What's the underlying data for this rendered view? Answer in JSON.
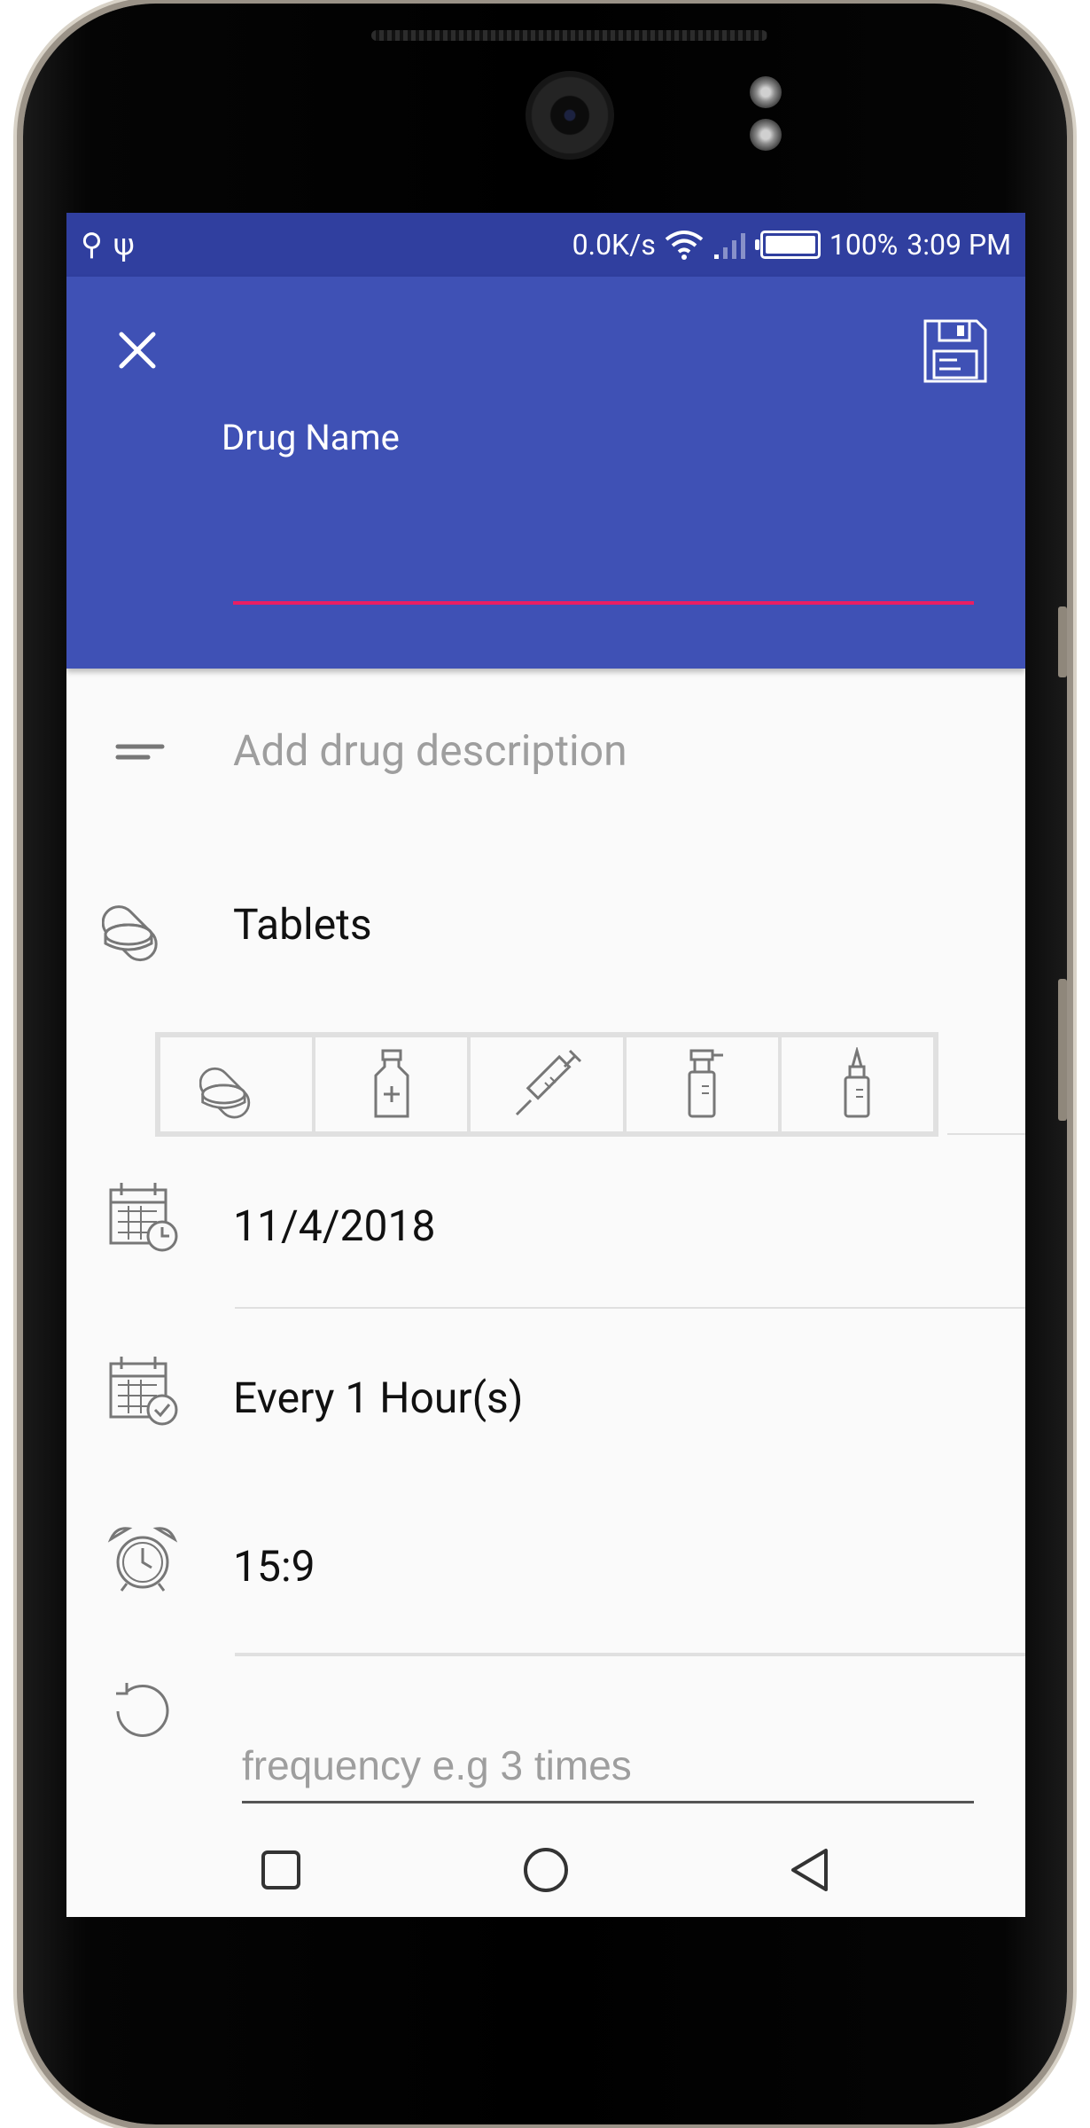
{
  "status_bar": {
    "left_icons": [
      "usb-icon",
      "usb-icon"
    ],
    "net_speed": "0.0K/s",
    "battery": "100%",
    "time": "3:09 PM"
  },
  "app_bar": {
    "title_label": "Drug Name",
    "input_value": ""
  },
  "form": {
    "description_placeholder": "Add drug description",
    "drug_type": "Tablets",
    "drug_type_options": [
      "tablets-icon",
      "bottle-icon",
      "syringe-icon",
      "spray-icon",
      "drops-icon"
    ],
    "start_date": "11/4/2018",
    "repeat": "Every 1 Hour(s)",
    "time": "15:9",
    "frequency_placeholder": "frequency e.g 3 times"
  },
  "nav_bar": {
    "buttons": [
      "recents-button",
      "home-button",
      "back-button"
    ]
  },
  "colors": {
    "status_bar": "#303f9f",
    "app_bar": "#3f51b5",
    "accent": "#e91e63",
    "background": "#fafafa"
  }
}
